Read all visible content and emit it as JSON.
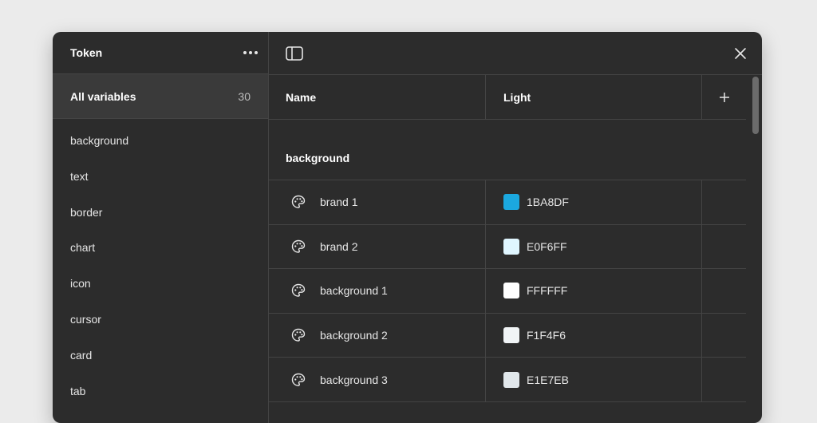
{
  "panel": {
    "title": "Token",
    "all_variables_label": "All variables",
    "all_variables_count": "30",
    "groups": [
      "background",
      "text",
      "border",
      "chart",
      "icon",
      "cursor",
      "card",
      "tab"
    ]
  },
  "icons": {
    "more": "more-horizontal-icon",
    "panel_toggle": "sidebar-toggle-icon",
    "close": "close-icon",
    "add": "plus-icon",
    "variable": "palette-icon"
  },
  "table": {
    "columns": {
      "name": "Name",
      "mode": "Light"
    },
    "group_title": "background",
    "rows": [
      {
        "name": "brand 1",
        "value": "1BA8DF",
        "color": "#1BA8DF"
      },
      {
        "name": "brand 2",
        "value": "E0F6FF",
        "color": "#E0F6FF"
      },
      {
        "name": "background 1",
        "value": "FFFFFF",
        "color": "#FFFFFF"
      },
      {
        "name": "background 2",
        "value": "F1F4F6",
        "color": "#F1F4F6"
      },
      {
        "name": "background 3",
        "value": "E1E7EB",
        "color": "#E1E7EB"
      }
    ]
  },
  "colors": {
    "page_bg": "#ebebeb",
    "window_bg": "#2c2c2c",
    "selected_bg": "#3a3a3a",
    "divider": "#444444"
  }
}
